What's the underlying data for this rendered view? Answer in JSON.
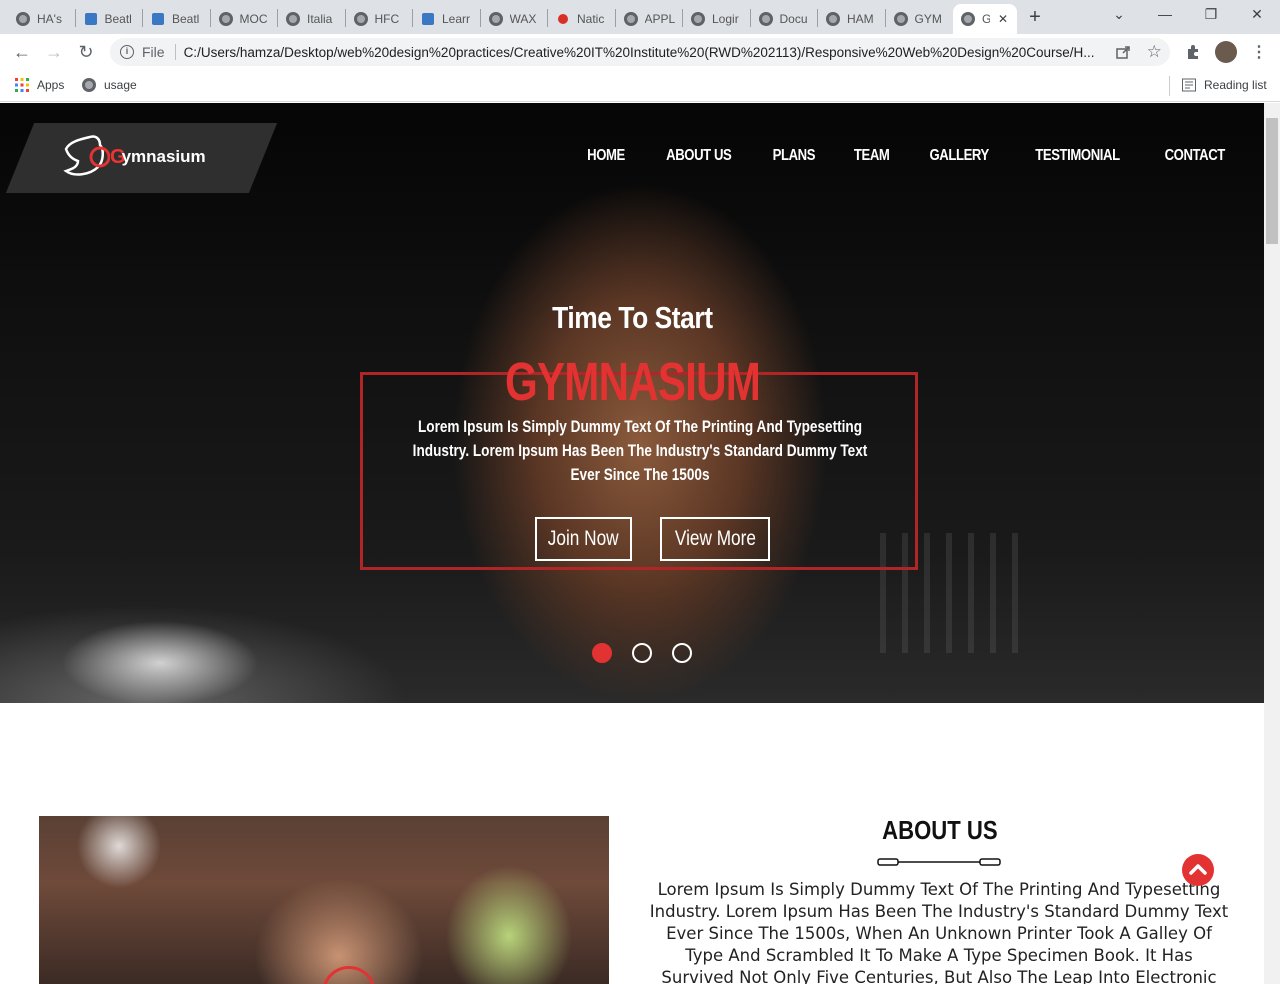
{
  "browser": {
    "tabs": [
      {
        "label": "HA's",
        "icon": "globe-icon"
      },
      {
        "label": "Beatl",
        "icon": "site-icon"
      },
      {
        "label": "Beatl",
        "icon": "site-icon"
      },
      {
        "label": "MOC",
        "icon": "globe-icon"
      },
      {
        "label": "Italia",
        "icon": "globe-icon"
      },
      {
        "label": "HFC",
        "icon": "globe-icon"
      },
      {
        "label": "Learr",
        "icon": "site-icon"
      },
      {
        "label": "WAX",
        "icon": "globe-icon"
      },
      {
        "label": "Natic",
        "icon": "record-icon"
      },
      {
        "label": "APPL",
        "icon": "globe-icon"
      },
      {
        "label": "Logir",
        "icon": "globe-icon"
      },
      {
        "label": "Docu",
        "icon": "globe-icon"
      },
      {
        "label": "HAM",
        "icon": "globe-icon"
      },
      {
        "label": "GYM",
        "icon": "globe-icon"
      },
      {
        "label": "G",
        "icon": "globe-icon",
        "active": true
      }
    ],
    "address": {
      "scheme_label": "File",
      "url": "C:/Users/hamza/Desktop/web%20design%20practices/Creative%20IT%20Institute%20(RWD%202113)/Responsive%20Web%20Design%20Course/H..."
    },
    "bookmarks": {
      "apps": "Apps",
      "usage": "usage",
      "reading_list": "Reading list"
    }
  },
  "site": {
    "logo": {
      "letter": "G",
      "text": "ymnasium"
    },
    "nav": [
      "HOME",
      "ABOUT US",
      "PLANS",
      "TEAM",
      "GALLERY",
      "TESTIMONIAL",
      "CONTACT"
    ],
    "hero": {
      "subtitle": "Time To Start",
      "title": "GYMNASIUM",
      "text": "Lorem Ipsum Is Simply Dummy Text Of The Printing And Typesetting Industry. Lorem Ipsum Has Been The Industry's Standard Dummy Text Ever Since The 1500s",
      "join_label": "Join Now",
      "more_label": "View More",
      "slides": 3,
      "active_slide": 1
    },
    "about": {
      "title": "ABOUT US",
      "text": "Lorem Ipsum Is Simply Dummy Text Of The Printing And Typesetting Industry. Lorem Ipsum Has Been The Industry's Standard Dummy Text Ever Since The 1500s, When An Unknown Printer Took A Galley Of Type And Scrambled It To Make A Type Specimen Book. It Has Survived Not Only Five Centuries, But Also The Leap Into Electronic Typesetting."
    },
    "colors": {
      "accent": "#e33232",
      "dark": "#111111"
    }
  }
}
